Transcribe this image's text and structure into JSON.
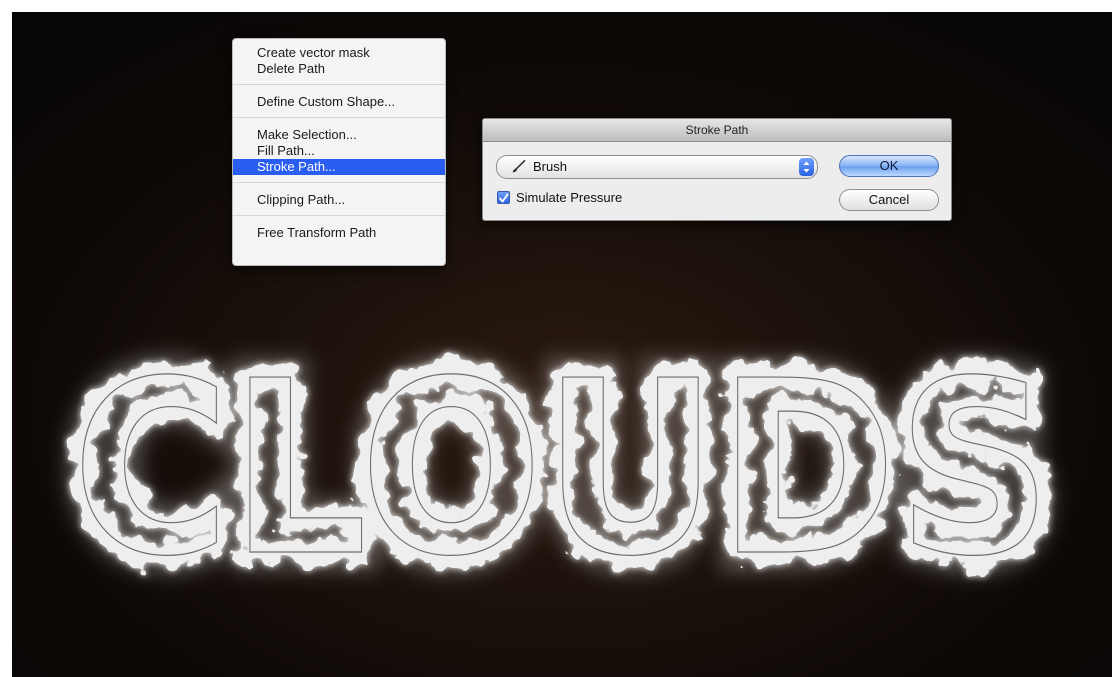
{
  "context_menu": {
    "items": [
      "Create vector mask",
      "Delete Path",
      "Define Custom Shape...",
      "Make Selection...",
      "Fill Path...",
      "Stroke Path...",
      "Clipping Path...",
      "Free Transform Path"
    ],
    "selected_item": "Stroke Path..."
  },
  "dialog": {
    "title": "Stroke Path",
    "tool_icon": "brush-icon",
    "tool_value": "Brush",
    "simulate_pressure_label": "Simulate Pressure",
    "simulate_pressure_checked": true,
    "ok_label": "OK",
    "cancel_label": "Cancel"
  },
  "artwork": {
    "text": "CLOUDS"
  },
  "colors": {
    "background": "#0e0907",
    "menu_highlight": "#2a5df2",
    "cloud": "#f2f2f2"
  }
}
